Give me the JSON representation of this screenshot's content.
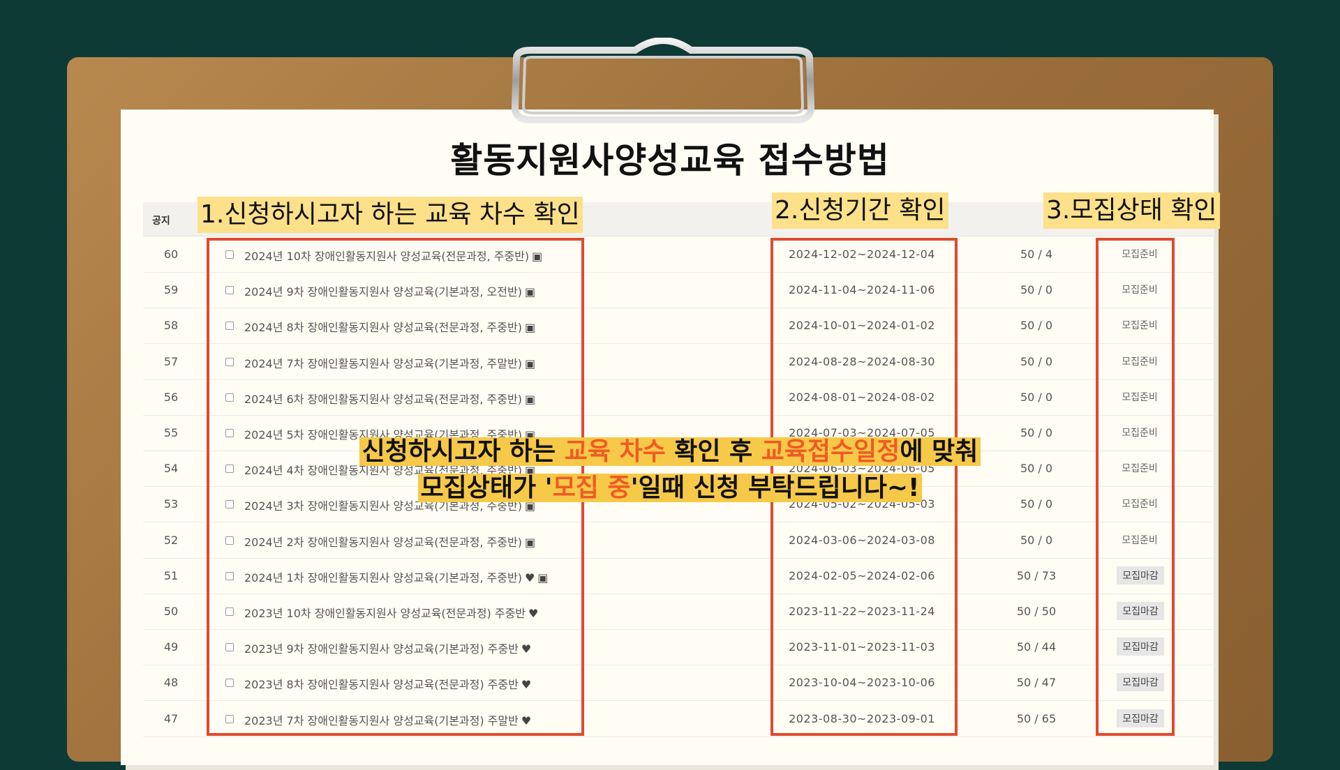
{
  "title": "활동지원사양성교육 접수방법",
  "header_label": "공지",
  "steps": {
    "step1": "1.신청하시고자 하는 교육 차수 확인",
    "step2": "2.신청기간 확인",
    "step3": "3.모집상태 확인"
  },
  "callout": {
    "line1_a": "신청하시고자 하는 ",
    "line1_hl1": "교육 차수",
    "line1_b": " 확인  후 ",
    "line1_hl2": "교육접수일정",
    "line1_c": "에 맞춰",
    "line2_a": "모집상태가 '",
    "line2_hl": "모집 중",
    "line2_b": "'일때 신청 부탁드립니다~!"
  },
  "icons": {
    "lock": "lock-icon",
    "heart": "heart-icon"
  },
  "colors": {
    "highlight": "#f05a24",
    "box": "#e14a2e",
    "step_bg": "#fde08a",
    "callout_bg": "#f7c948"
  },
  "rows": [
    {
      "num": "60",
      "title": "2024년 10차 장애인활동지원사 양성교육(전문과정, 주중반)",
      "icons": [
        "lock"
      ],
      "period": "2024-12-02~2024-12-04",
      "count": "50 / 4",
      "status": "모집준비"
    },
    {
      "num": "59",
      "title": "2024년 9차 장애인활동지원사 양성교육(기본과정, 오전반)",
      "icons": [
        "lock"
      ],
      "period": "2024-11-04~2024-11-06",
      "count": "50 / 0",
      "status": "모집준비"
    },
    {
      "num": "58",
      "title": "2024년 8차 장애인활동지원사 양성교육(전문과정, 주중반)",
      "icons": [
        "lock"
      ],
      "period": "2024-10-01~2024-01-02",
      "count": "50 / 0",
      "status": "모집준비"
    },
    {
      "num": "57",
      "title": "2024년 7차 장애인활동지원사 양성교육(기본과정, 주말반)",
      "icons": [
        "lock"
      ],
      "period": "2024-08-28~2024-08-30",
      "count": "50 / 0",
      "status": "모집준비"
    },
    {
      "num": "56",
      "title": "2024년 6차 장애인활동지원사 양성교육(전문과정, 주중반)",
      "icons": [
        "lock"
      ],
      "period": "2024-08-01~2024-08-02",
      "count": "50 / 0",
      "status": "모집준비"
    },
    {
      "num": "55",
      "title": "2024년 5차 장애인활동지원사 양성교육(기본과정, 주중반)",
      "icons": [
        "lock"
      ],
      "period": "2024-07-03~2024-07-05",
      "count": "50 / 0",
      "status": "모집준비"
    },
    {
      "num": "54",
      "title": "2024년 4차 장애인활동지원사 양성교육(전문과정, 주중반)",
      "icons": [
        "lock"
      ],
      "period": "2024-06-03~2024-06-05",
      "count": "50 / 0",
      "status": "모집준비"
    },
    {
      "num": "53",
      "title": "2024년 3차 장애인활동지원사 양성교육(기본과정, 주중반)",
      "icons": [
        "lock"
      ],
      "period": "2024-05-02~2024-05-03",
      "count": "50 / 0",
      "status": "모집준비"
    },
    {
      "num": "52",
      "title": "2024년 2차 장애인활동지원사 양성교육(전문과정, 주중반)",
      "icons": [
        "lock"
      ],
      "period": "2024-03-06~2024-03-08",
      "count": "50 / 0",
      "status": "모집준비"
    },
    {
      "num": "51",
      "title": "2024년 1차 장애인활동지원사 양성교육(기본과정, 주중반)",
      "icons": [
        "heart",
        "lock"
      ],
      "period": "2024-02-05~2024-02-06",
      "count": "50 / 73",
      "status": "모집마감"
    },
    {
      "num": "50",
      "title": "2023년 10차 장애인활동지원사 양성교육(전문과정) 주중반",
      "icons": [
        "heart"
      ],
      "period": "2023-11-22~2023-11-24",
      "count": "50 / 50",
      "status": "모집마감"
    },
    {
      "num": "49",
      "title": "2023년 9차 장애인활동지원사 양성교육(기본과정) 주중반",
      "icons": [
        "heart"
      ],
      "period": "2023-11-01~2023-11-03",
      "count": "50 / 44",
      "status": "모집마감"
    },
    {
      "num": "48",
      "title": "2023년 8차 장애인활동지원사 양성교육(전문과정) 주중반",
      "icons": [
        "heart"
      ],
      "period": "2023-10-04~2023-10-06",
      "count": "50 / 47",
      "status": "모집마감"
    },
    {
      "num": "47",
      "title": "2023년 7차 장애인활동지원사 양성교육(기본과정) 주말반",
      "icons": [
        "heart"
      ],
      "period": "2023-08-30~2023-09-01",
      "count": "50 / 65",
      "status": "모집마감"
    }
  ]
}
